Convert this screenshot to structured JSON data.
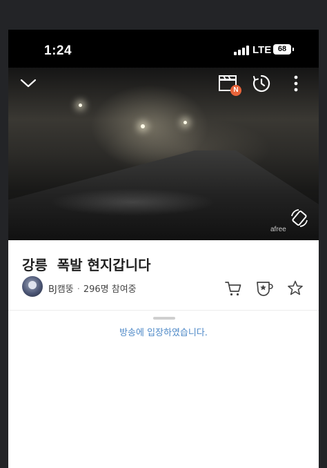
{
  "status_bar": {
    "time": "1:24",
    "network": "LTE",
    "battery": "68"
  },
  "player": {
    "collapse_icon": "chevron-down-icon",
    "clip_icon": "clapperboard-icon",
    "clip_badge": "N",
    "timer_icon": "clock-icon",
    "more_icon": "vertical-dots-icon",
    "rotate_icon": "rotate-screen-icon",
    "watermark": "afree"
  },
  "broadcast": {
    "title": "강릉  폭발 현지갑니다",
    "streamer": "BJ캠뚱",
    "separator": "·",
    "viewers": "296명 참여중"
  },
  "actions": [
    {
      "name": "cart-icon"
    },
    {
      "name": "star-badge-icon"
    },
    {
      "name": "star-icon"
    }
  ],
  "chat": {
    "system_message": "방송에 입장하였습니다."
  },
  "colors": {
    "chat_message": "#4d88c7",
    "clip_badge": "#e8643a"
  }
}
